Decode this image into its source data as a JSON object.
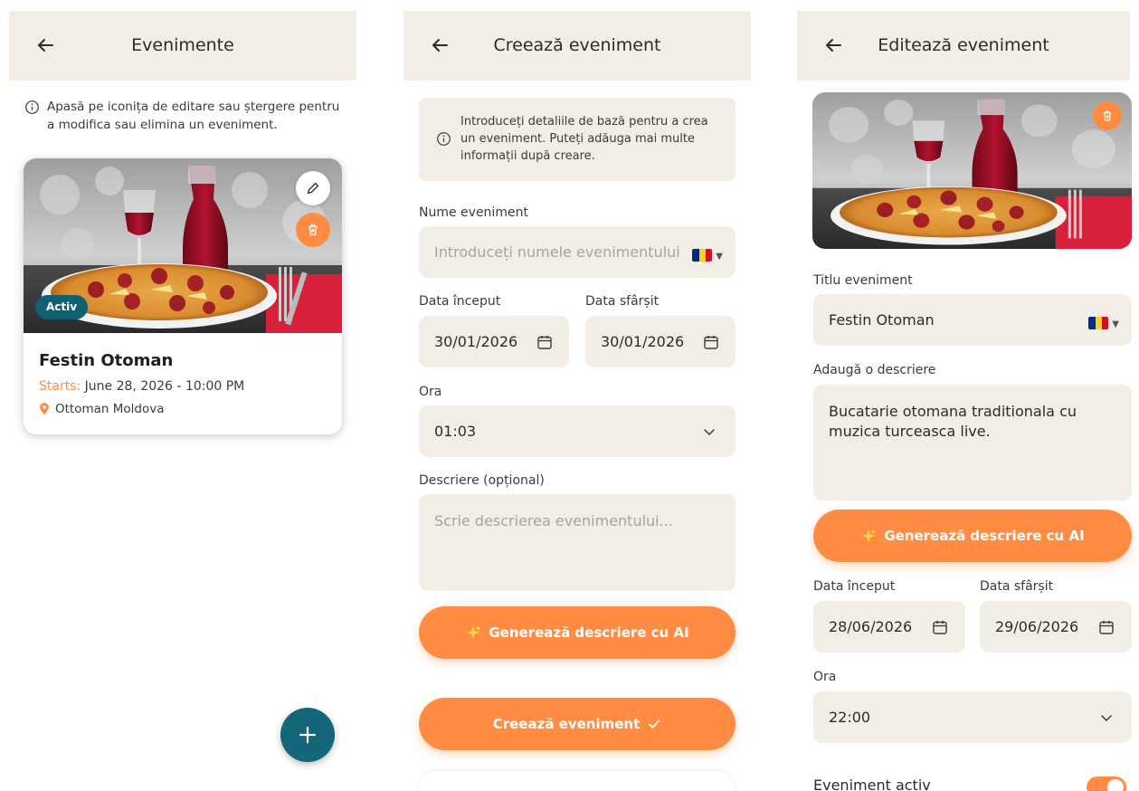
{
  "screen1": {
    "title": "Evenimente",
    "info_line1": "Apasă pe iconița de editare sau ștergere pentru",
    "info_line2": "a modifica sau elimina un eveniment.",
    "card": {
      "badge": "Activ",
      "title": "Festin Otoman",
      "starts_label": "Starts:",
      "starts_value": "June 28, 2026 - 10:00 PM",
      "location": "Ottoman Moldova"
    }
  },
  "screen2": {
    "title": "Creează eveniment",
    "info_line1": "Introduceți detaliile de bază pentru a crea",
    "info_line2": "un eveniment. Puteți adăuga mai multe",
    "info_line3": "informații după creare.",
    "name_label": "Nume eveniment",
    "name_placeholder": "Introduceți numele evenimentului",
    "start_label": "Data început",
    "start_value": "30/01/2026",
    "end_label": "Data sfârșit",
    "end_value": "30/01/2026",
    "time_label": "Ora",
    "time_value": "01:03",
    "desc_label": "Descriere (opțional)",
    "desc_placeholder": "Scrie descrierea evenimentului...",
    "ai_button": "Generează descriere cu AI",
    "create_button": "Creează eveniment"
  },
  "screen3": {
    "title": "Editează eveniment",
    "title_label": "Titlu eveniment",
    "title_value": "Festin Otoman",
    "desc_label": "Adaugă o descriere",
    "desc_line1": "Bucatarie otomana traditionala cu",
    "desc_line2": "muzica turceasca live.",
    "ai_button": "Generează descriere cu AI",
    "start_label": "Data început",
    "start_value": "28/06/2026",
    "end_label": "Data sfârșit",
    "end_value": "29/06/2026",
    "time_label": "Ora",
    "time_value": "22:00",
    "active_label": "Eveniment activ"
  },
  "colors": {
    "accent": "#ff8c42",
    "teal": "#14667a",
    "field_bg": "#f2eee6"
  },
  "icons": [
    "back-arrow-icon",
    "info-icon",
    "pencil-icon",
    "trash-icon",
    "location-pin-icon",
    "plus-icon",
    "calendar-icon",
    "chevron-down-icon",
    "sparkle-icon",
    "check-icon",
    "romania-flag-icon"
  ]
}
